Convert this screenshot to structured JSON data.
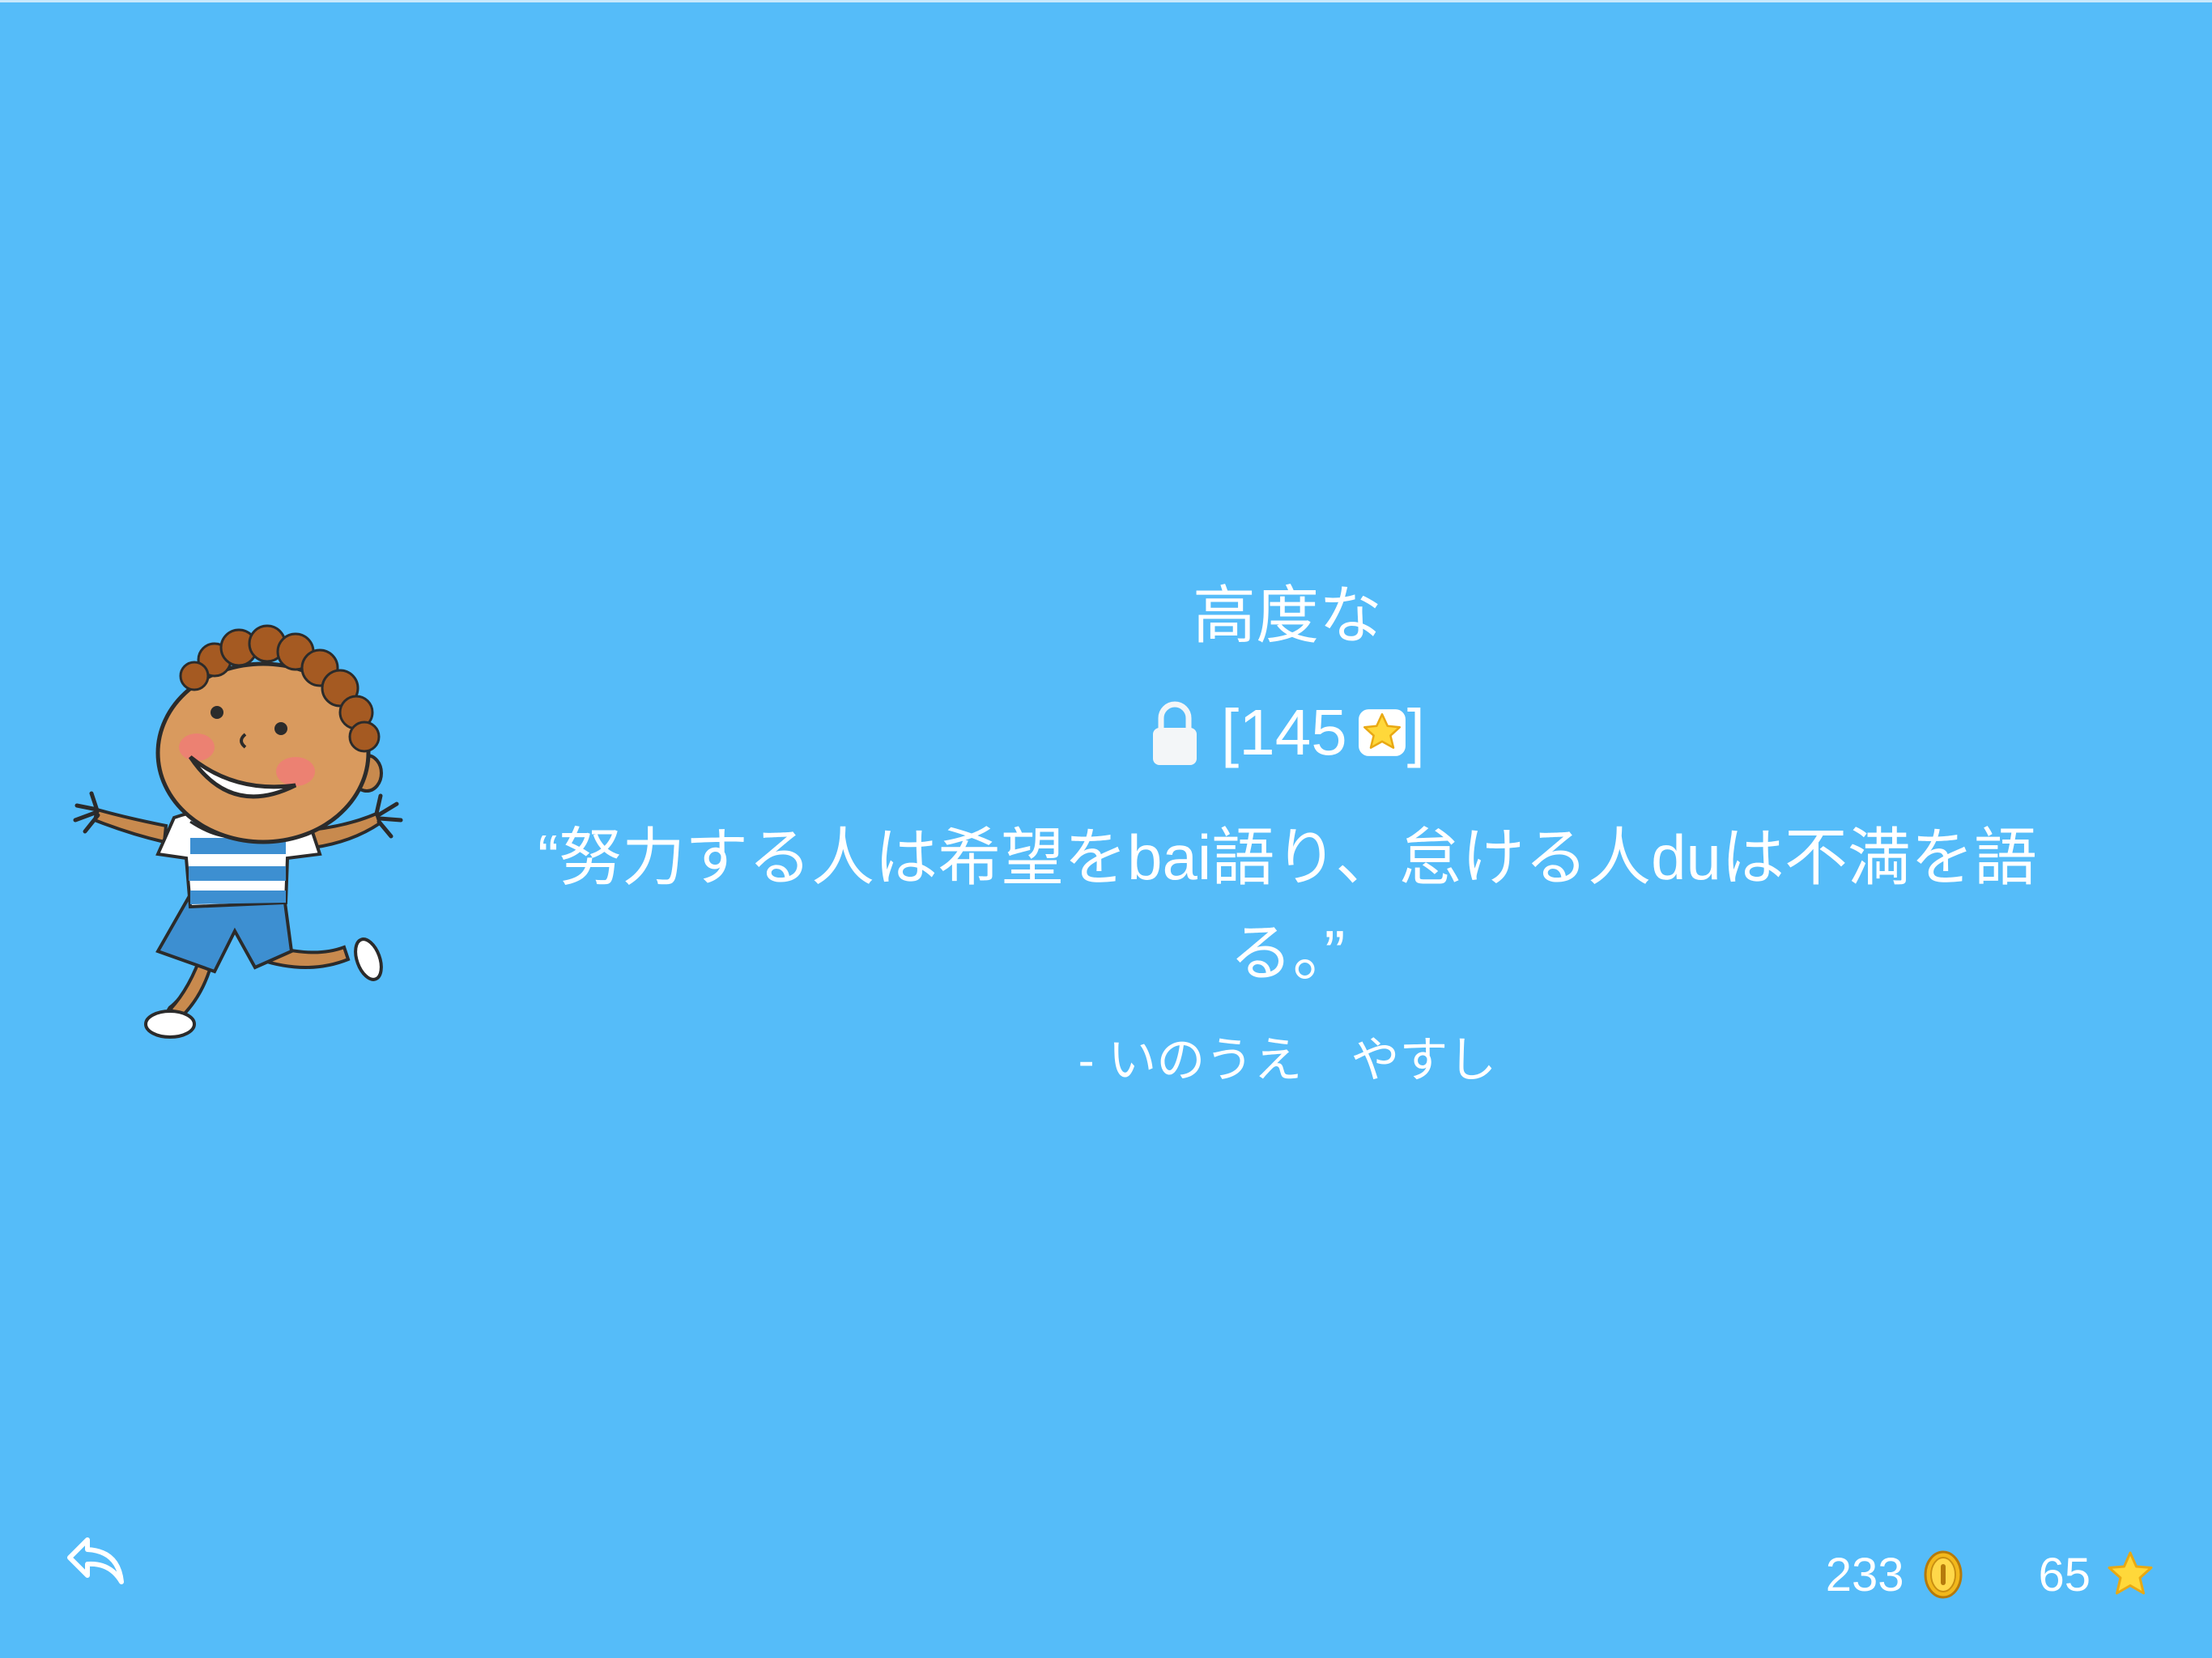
{
  "level": {
    "title": "高度な",
    "lock_open_bracket": "[",
    "stars_required": "145",
    "lock_close_bracket": "]"
  },
  "quote": {
    "text": "“努力する人は希望をbai語り、怠ける人duは不満を語る。”",
    "author": "- いのうえ　やすし"
  },
  "stats": {
    "coins": "233",
    "stars": "65"
  },
  "icons": {
    "back": "back-arrow-icon",
    "lock": "lock-icon",
    "star": "star-icon",
    "coin": "coin-icon"
  },
  "colors": {
    "background": "#55bcf9",
    "text": "#ffffff",
    "star": "#ffd83a",
    "coin": "#f2b81c"
  }
}
